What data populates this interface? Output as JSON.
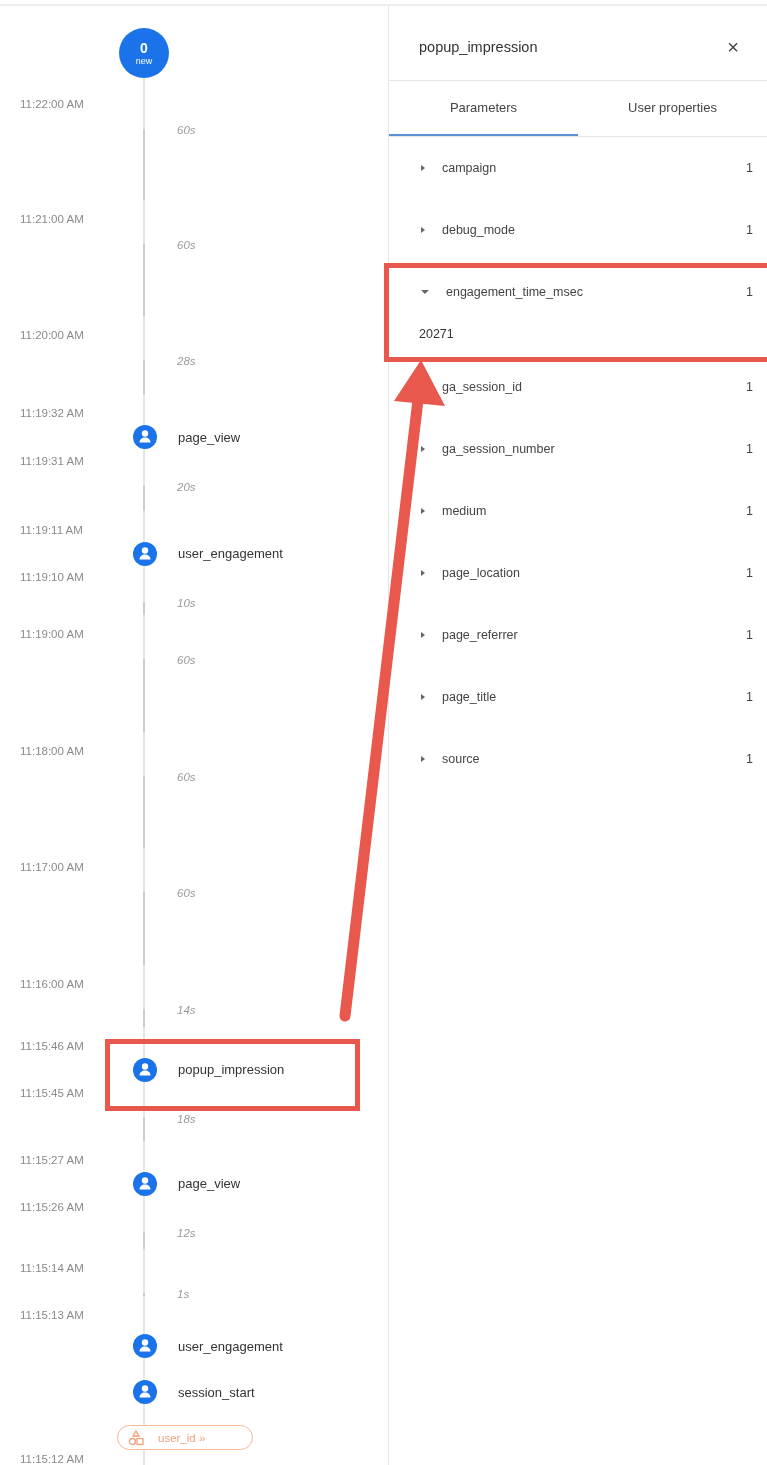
{
  "timeline": {
    "head": {
      "count": "0",
      "label": "new"
    },
    "items": [
      {
        "kind": "time",
        "text": "11:22:00 AM"
      },
      {
        "kind": "gap",
        "text": "60s"
      },
      {
        "kind": "time",
        "text": "11:21:00 AM"
      },
      {
        "kind": "gap",
        "text": "60s"
      },
      {
        "kind": "time",
        "text": "11:20:00 AM"
      },
      {
        "kind": "gap",
        "text": "28s"
      },
      {
        "kind": "time",
        "text": "11:19:32 AM"
      },
      {
        "kind": "event",
        "name": "page_view",
        "highlighted": false
      },
      {
        "kind": "time",
        "text": "11:19:31 AM"
      },
      {
        "kind": "gap",
        "text": "20s"
      },
      {
        "kind": "time",
        "text": "11:19:11 AM"
      },
      {
        "kind": "event",
        "name": "user_engagement",
        "highlighted": false
      },
      {
        "kind": "time",
        "text": "11:19:10 AM"
      },
      {
        "kind": "gap",
        "text": "10s"
      },
      {
        "kind": "time",
        "text": "11:19:00 AM"
      },
      {
        "kind": "gap",
        "text": "60s"
      },
      {
        "kind": "time",
        "text": "11:18:00 AM"
      },
      {
        "kind": "gap",
        "text": "60s"
      },
      {
        "kind": "time",
        "text": "11:17:00 AM"
      },
      {
        "kind": "gap",
        "text": "60s"
      },
      {
        "kind": "time",
        "text": "11:16:00 AM"
      },
      {
        "kind": "gap",
        "text": "14s"
      },
      {
        "kind": "time",
        "text": "11:15:46 AM"
      },
      {
        "kind": "event",
        "name": "popup_impression",
        "highlighted": true
      },
      {
        "kind": "time",
        "text": "11:15:45 AM"
      },
      {
        "kind": "gap",
        "text": "18s"
      },
      {
        "kind": "time",
        "text": "11:15:27 AM"
      },
      {
        "kind": "event",
        "name": "page_view",
        "highlighted": false
      },
      {
        "kind": "time",
        "text": "11:15:26 AM"
      },
      {
        "kind": "gap",
        "text": "12s"
      },
      {
        "kind": "time",
        "text": "11:15:14 AM"
      },
      {
        "kind": "gap",
        "text": "1s"
      },
      {
        "kind": "time",
        "text": "11:15:13 AM"
      },
      {
        "kind": "event",
        "name": "user_engagement",
        "highlighted": false
      },
      {
        "kind": "event",
        "name": "session_start",
        "highlighted": false
      },
      {
        "kind": "user_property",
        "text": "user_id »"
      },
      {
        "kind": "time",
        "text": "11:15:12 AM"
      }
    ]
  },
  "details": {
    "title": "popup_impression",
    "close": "×",
    "tabs": [
      {
        "label": "Parameters",
        "selected": true
      },
      {
        "label": "User properties",
        "selected": false
      }
    ],
    "parameters": [
      {
        "name": "campaign",
        "count": "1",
        "expanded": false,
        "highlighted": false
      },
      {
        "name": "debug_mode",
        "count": "1",
        "expanded": false,
        "highlighted": false
      },
      {
        "name": "engagement_time_msec",
        "count": "1",
        "expanded": true,
        "value": "20271",
        "highlighted": true
      },
      {
        "name": "ga_session_id",
        "count": "1",
        "expanded": false,
        "highlighted": false
      },
      {
        "name": "ga_session_number",
        "count": "1",
        "expanded": false,
        "highlighted": false
      },
      {
        "name": "medium",
        "count": "1",
        "expanded": false,
        "highlighted": false
      },
      {
        "name": "page_location",
        "count": "1",
        "expanded": false,
        "highlighted": false
      },
      {
        "name": "page_referrer",
        "count": "1",
        "expanded": false,
        "highlighted": false
      },
      {
        "name": "page_title",
        "count": "1",
        "expanded": false,
        "highlighted": false
      },
      {
        "name": "source",
        "count": "1",
        "expanded": false,
        "highlighted": false
      }
    ]
  }
}
